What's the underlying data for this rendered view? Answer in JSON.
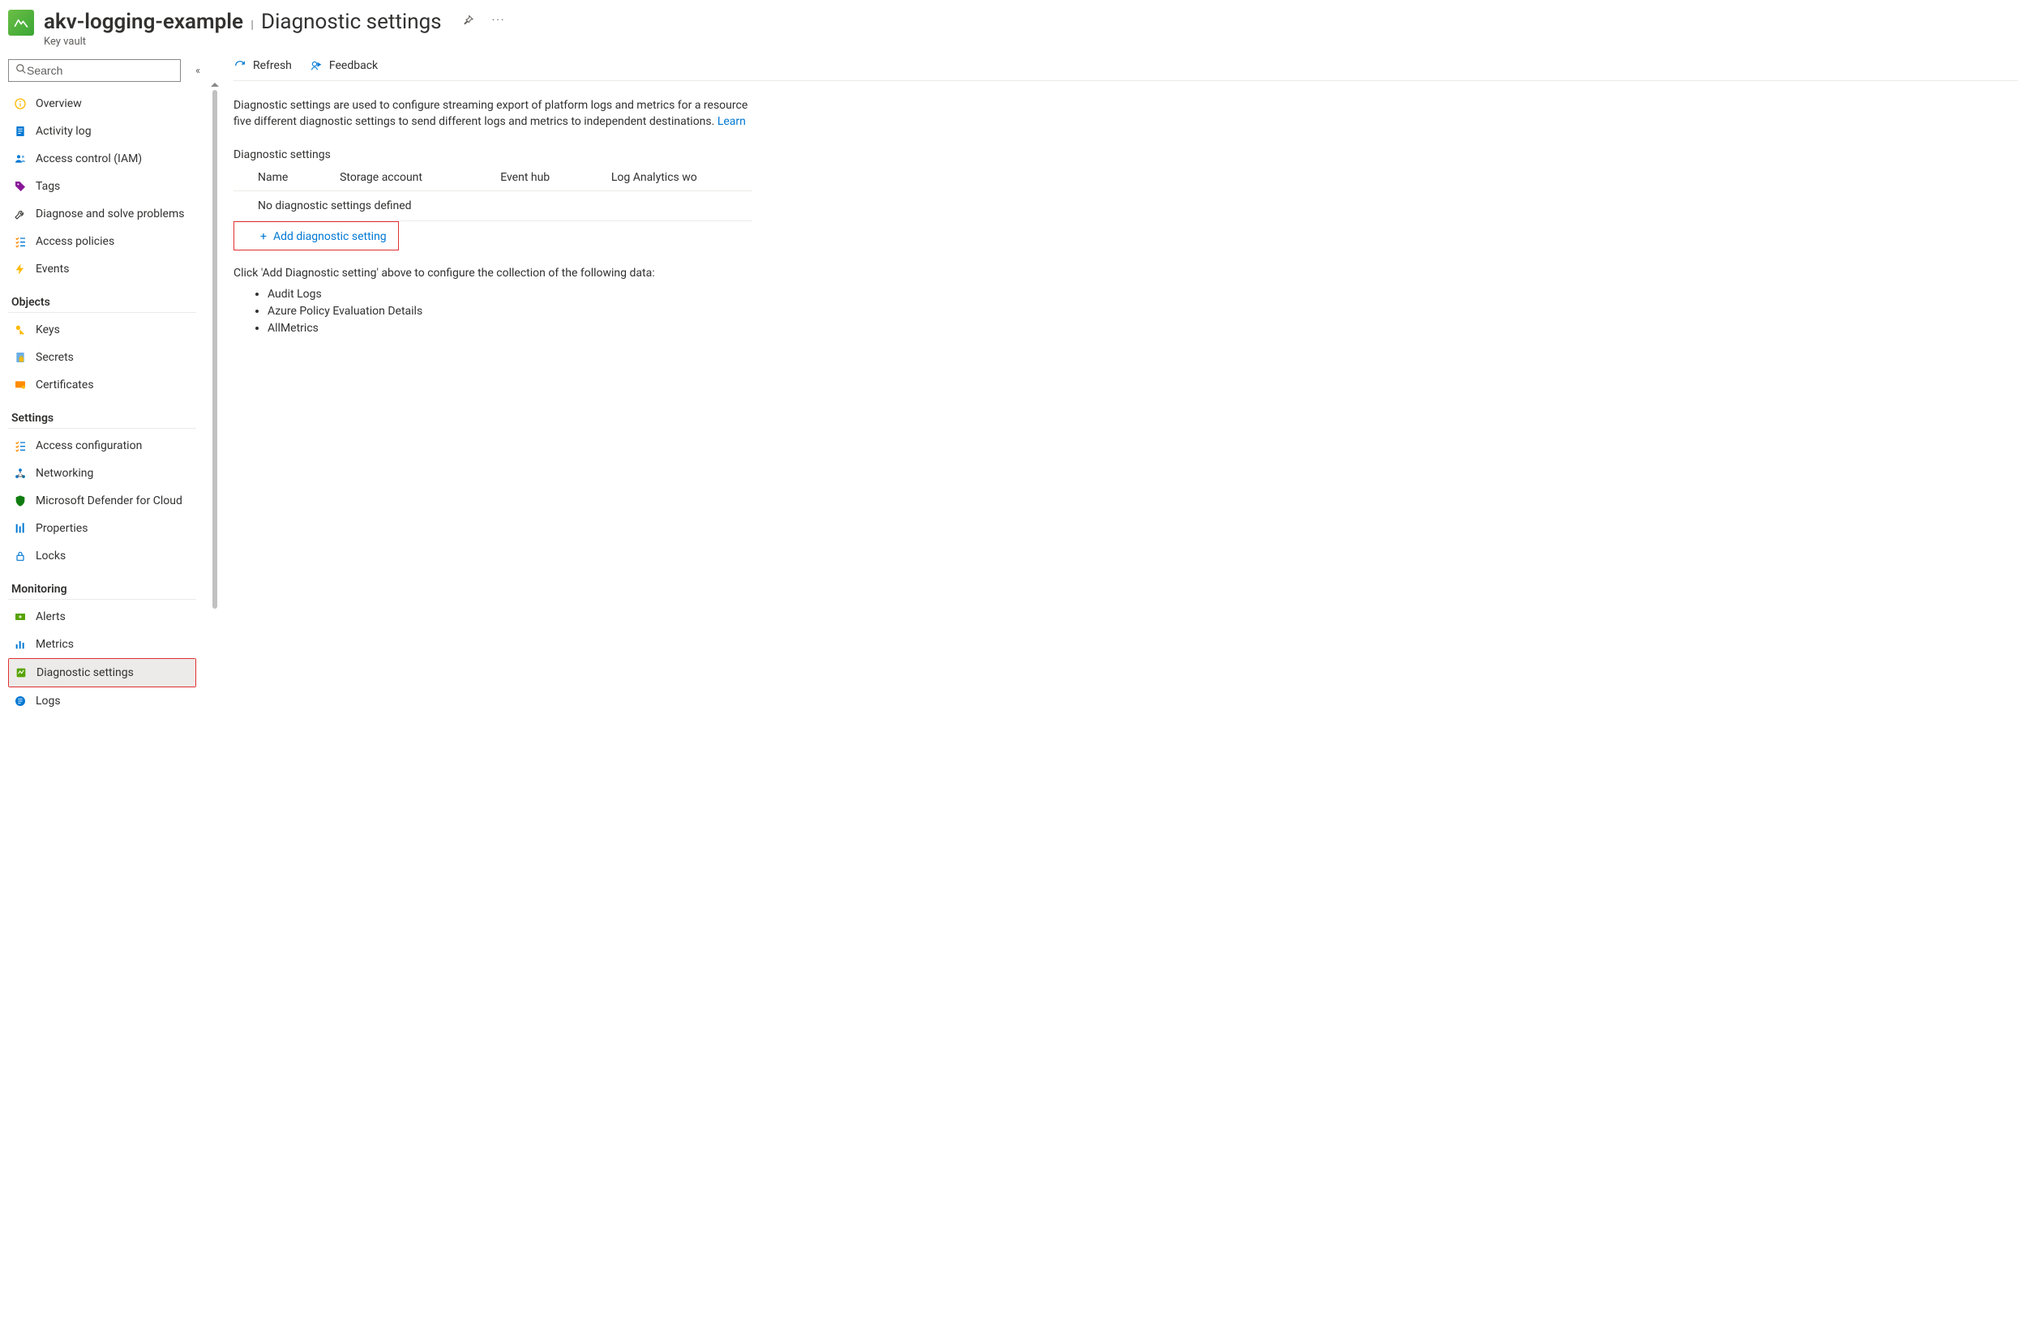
{
  "header": {
    "resource_name": "akv-logging-example",
    "page_title": "Diagnostic settings",
    "resource_type": "Key vault"
  },
  "search": {
    "placeholder": "Search"
  },
  "sidebar": {
    "top": [
      {
        "label": "Overview"
      },
      {
        "label": "Activity log"
      },
      {
        "label": "Access control (IAM)"
      },
      {
        "label": "Tags"
      },
      {
        "label": "Diagnose and solve problems"
      },
      {
        "label": "Access policies"
      },
      {
        "label": "Events"
      }
    ],
    "sections": [
      {
        "title": "Objects",
        "items": [
          {
            "label": "Keys"
          },
          {
            "label": "Secrets"
          },
          {
            "label": "Certificates"
          }
        ]
      },
      {
        "title": "Settings",
        "items": [
          {
            "label": "Access configuration"
          },
          {
            "label": "Networking"
          },
          {
            "label": "Microsoft Defender for Cloud"
          },
          {
            "label": "Properties"
          },
          {
            "label": "Locks"
          }
        ]
      },
      {
        "title": "Monitoring",
        "items": [
          {
            "label": "Alerts"
          },
          {
            "label": "Metrics"
          },
          {
            "label": "Diagnostic settings"
          },
          {
            "label": "Logs"
          }
        ]
      }
    ]
  },
  "toolbar": {
    "refresh": "Refresh",
    "feedback": "Feedback"
  },
  "content": {
    "description": "Diagnostic settings are used to configure streaming export of platform logs and metrics for a resource five different diagnostic settings to send different logs and metrics to independent destinations. ",
    "learn_more": "Learn ",
    "sub_heading": "Diagnostic settings",
    "table": {
      "columns": [
        "Name",
        "Storage account",
        "Event hub",
        "Log Analytics wo"
      ],
      "empty_message": "No diagnostic settings defined"
    },
    "add_label": "Add diagnostic setting",
    "instruction": "Click 'Add Diagnostic setting' above to configure the collection of the following data:",
    "bullets": [
      "Audit Logs",
      "Azure Policy Evaluation Details",
      "AllMetrics"
    ]
  }
}
